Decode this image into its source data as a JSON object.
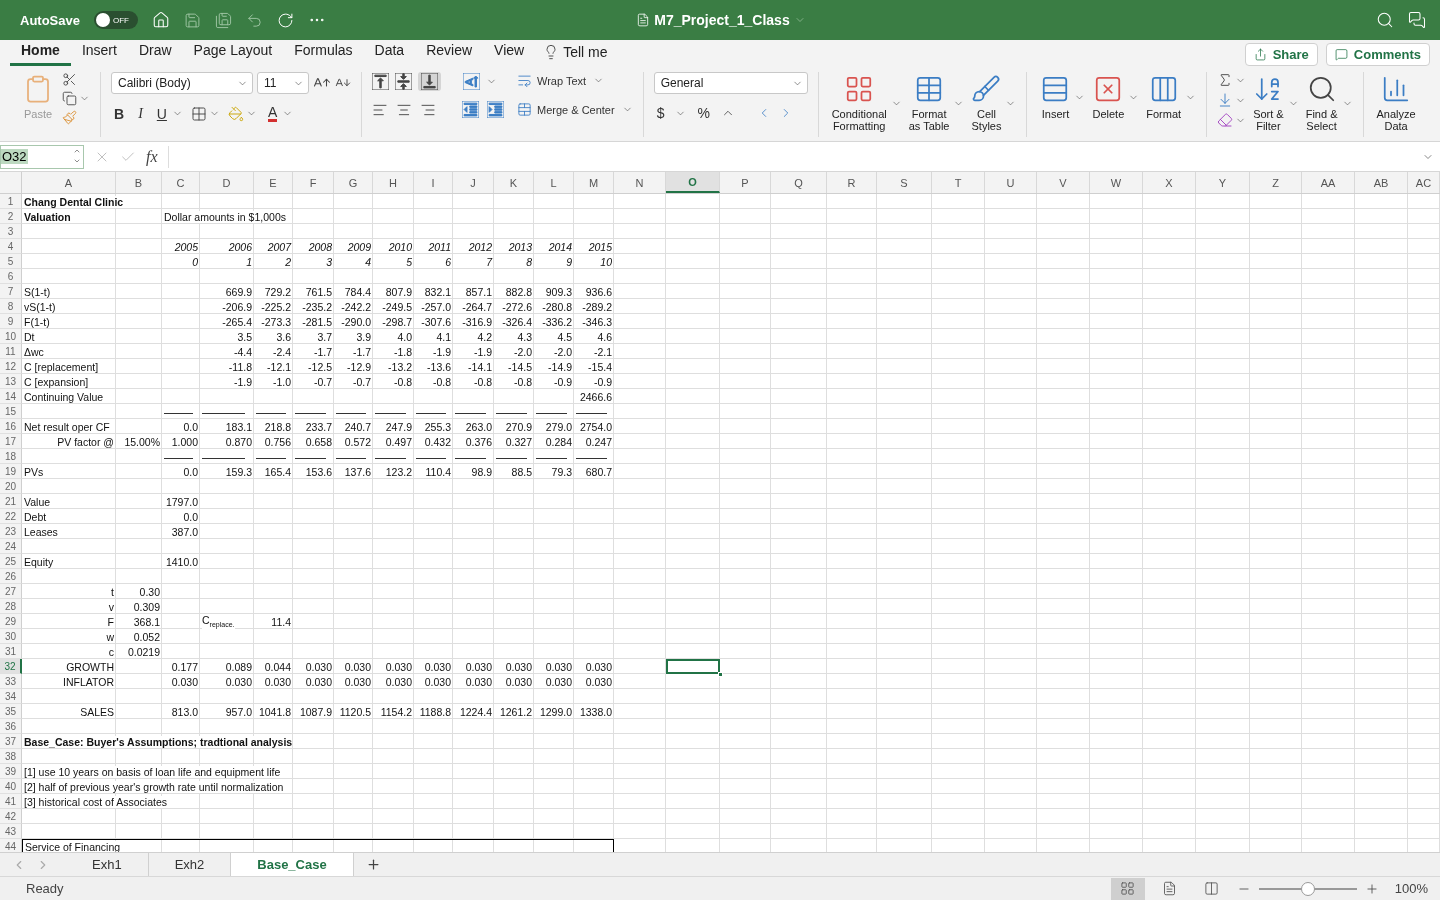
{
  "title_bar": {
    "autosave": {
      "label": "AutoSave",
      "state": "OFF",
      "on": false
    },
    "title": "M7_Project_1_Class"
  },
  "menu_tabs": [
    {
      "label": "Home",
      "selected": true
    },
    {
      "label": "Insert",
      "selected": false
    },
    {
      "label": "Draw",
      "selected": false
    },
    {
      "label": "Page Layout",
      "selected": false
    },
    {
      "label": "Formulas",
      "selected": false
    },
    {
      "label": "Data",
      "selected": false
    },
    {
      "label": "Review",
      "selected": false
    },
    {
      "label": "View",
      "selected": false
    }
  ],
  "tell_me": "Tell me",
  "share": "Share",
  "comments": "Comments",
  "ribbon": {
    "paste": "Paste",
    "font_name": "Calibri (Body)",
    "font_size": "11",
    "bold": "B",
    "italic": "I",
    "underline": "U",
    "font_color": "A",
    "wrap_text": "Wrap Text",
    "merge_center": "Merge & Center",
    "number_format": "General",
    "currency": "$",
    "percent": "%",
    "large_buttons": [
      {
        "kind": "conditional",
        "lines": [
          "Conditional",
          "Formatting"
        ]
      },
      {
        "kind": "table",
        "lines": [
          "Format",
          "as Table"
        ]
      },
      {
        "kind": "styles",
        "lines": [
          "Cell",
          "Styles"
        ]
      },
      {
        "kind": "insert",
        "lines": [
          "Insert"
        ]
      },
      {
        "kind": "delete",
        "lines": [
          "Delete"
        ]
      },
      {
        "kind": "format",
        "lines": [
          "Format"
        ]
      },
      {
        "kind": "sort",
        "lines": [
          "Sort &",
          "Filter"
        ]
      },
      {
        "kind": "find",
        "lines": [
          "Find &",
          "Select"
        ]
      },
      {
        "kind": "analyze",
        "lines": [
          "Analyze",
          "Data"
        ]
      }
    ]
  },
  "formula_bar": {
    "name_box": "O32",
    "function_label": "fx"
  },
  "columns": [
    {
      "label": "A",
      "selected": false
    },
    {
      "label": "B",
      "selected": false
    },
    {
      "label": "C",
      "selected": false
    },
    {
      "label": "D",
      "selected": false
    },
    {
      "label": "E",
      "selected": false
    },
    {
      "label": "F",
      "selected": false
    },
    {
      "label": "G",
      "selected": false
    },
    {
      "label": "H",
      "selected": false
    },
    {
      "label": "I",
      "selected": false
    },
    {
      "label": "J",
      "selected": false
    },
    {
      "label": "K",
      "selected": false
    },
    {
      "label": "L",
      "selected": false
    },
    {
      "label": "M",
      "selected": false
    },
    {
      "label": "N",
      "selected": false
    },
    {
      "label": "O",
      "selected": true
    },
    {
      "label": "P",
      "selected": false
    },
    {
      "label": "Q",
      "selected": false
    },
    {
      "label": "R",
      "selected": false
    },
    {
      "label": "S",
      "selected": false
    },
    {
      "label": "T",
      "selected": false
    },
    {
      "label": "U",
      "selected": false
    },
    {
      "label": "V",
      "selected": false
    },
    {
      "label": "W",
      "selected": false
    },
    {
      "label": "X",
      "selected": false
    },
    {
      "label": "Y",
      "selected": false
    },
    {
      "label": "Z",
      "selected": false
    },
    {
      "label": "AA",
      "selected": false
    },
    {
      "label": "AB",
      "selected": false
    },
    {
      "label": "AC",
      "selected": false
    }
  ],
  "rows": [
    {
      "number": "1",
      "selected": false,
      "cells": {
        "A": {
          "kind": "text",
          "text": "Chang Dental Clinic",
          "bold": true
        }
      }
    },
    {
      "number": "2",
      "selected": false,
      "cells": {
        "A": {
          "kind": "text",
          "text": "Valuation",
          "bold": true
        },
        "C": {
          "kind": "text",
          "text": "Dollar amounts in $1,000s"
        }
      }
    },
    {
      "number": "3",
      "selected": false
    },
    {
      "number": "4",
      "selected": false,
      "cells": {
        "C": {
          "kind": "value",
          "text": "2005",
          "italic": true
        },
        "D": {
          "kind": "value",
          "text": "2006",
          "italic": true
        },
        "E": {
          "kind": "value",
          "text": "2007",
          "italic": true
        },
        "F": {
          "kind": "value",
          "text": "2008",
          "italic": true
        },
        "G": {
          "kind": "value",
          "text": "2009",
          "italic": true
        },
        "H": {
          "kind": "value",
          "text": "2010",
          "italic": true
        },
        "I": {
          "kind": "value",
          "text": "2011",
          "italic": true
        },
        "J": {
          "kind": "value",
          "text": "2012",
          "italic": true
        },
        "K": {
          "kind": "value",
          "text": "2013",
          "italic": true
        },
        "L": {
          "kind": "value",
          "text": "2014",
          "italic": true
        },
        "M": {
          "kind": "value",
          "text": "2015",
          "italic": true
        }
      }
    },
    {
      "number": "5",
      "selected": false,
      "cells": {
        "C": {
          "kind": "value",
          "text": "0",
          "italic": true
        },
        "D": {
          "kind": "value",
          "text": "1",
          "italic": true
        },
        "E": {
          "kind": "value",
          "text": "2",
          "italic": true
        },
        "F": {
          "kind": "value",
          "text": "3",
          "italic": true
        },
        "G": {
          "kind": "value",
          "text": "4",
          "italic": true
        },
        "H": {
          "kind": "value",
          "text": "5",
          "italic": true
        },
        "I": {
          "kind": "value",
          "text": "6",
          "italic": true
        },
        "J": {
          "kind": "value",
          "text": "7",
          "italic": true
        },
        "K": {
          "kind": "value",
          "text": "8",
          "italic": true
        },
        "L": {
          "kind": "value",
          "text": "9",
          "italic": true
        },
        "M": {
          "kind": "value",
          "text": "10",
          "italic": true
        }
      }
    },
    {
      "number": "6",
      "selected": false
    },
    {
      "number": "7",
      "selected": false,
      "cells": {
        "A": {
          "kind": "text",
          "text": "S(1-t)"
        },
        "D": {
          "kind": "value",
          "text": "669.9"
        },
        "E": {
          "kind": "value",
          "text": "729.2"
        },
        "F": {
          "kind": "value",
          "text": "761.5"
        },
        "G": {
          "kind": "value",
          "text": "784.4"
        },
        "H": {
          "kind": "value",
          "text": "807.9"
        },
        "I": {
          "kind": "value",
          "text": "832.1"
        },
        "J": {
          "kind": "value",
          "text": "857.1"
        },
        "K": {
          "kind": "value",
          "text": "882.8"
        },
        "L": {
          "kind": "value",
          "text": "909.3"
        },
        "M": {
          "kind": "value",
          "text": "936.6"
        }
      }
    },
    {
      "number": "8",
      "selected": false,
      "cells": {
        "A": {
          "kind": "text",
          "text": "vS(1-t)"
        },
        "D": {
          "kind": "value",
          "text": "-206.9"
        },
        "E": {
          "kind": "value",
          "text": "-225.2"
        },
        "F": {
          "kind": "value",
          "text": "-235.2"
        },
        "G": {
          "kind": "value",
          "text": "-242.2"
        },
        "H": {
          "kind": "value",
          "text": "-249.5"
        },
        "I": {
          "kind": "value",
          "text": "-257.0"
        },
        "J": {
          "kind": "value",
          "text": "-264.7"
        },
        "K": {
          "kind": "value",
          "text": "-272.6"
        },
        "L": {
          "kind": "value",
          "text": "-280.8"
        },
        "M": {
          "kind": "value",
          "text": "-289.2"
        }
      }
    },
    {
      "number": "9",
      "selected": false,
      "cells": {
        "A": {
          "kind": "text",
          "text": "F(1-t)"
        },
        "D": {
          "kind": "value",
          "text": "-265.4"
        },
        "E": {
          "kind": "value",
          "text": "-273.3"
        },
        "F": {
          "kind": "value",
          "text": "-281.5"
        },
        "G": {
          "kind": "value",
          "text": "-290.0"
        },
        "H": {
          "kind": "value",
          "text": "-298.7"
        },
        "I": {
          "kind": "value",
          "text": "-307.6"
        },
        "J": {
          "kind": "value",
          "text": "-316.9"
        },
        "K": {
          "kind": "value",
          "text": "-326.4"
        },
        "L": {
          "kind": "value",
          "text": "-336.2"
        },
        "M": {
          "kind": "value",
          "text": "-346.3"
        }
      }
    },
    {
      "number": "10",
      "selected": false,
      "cells": {
        "A": {
          "kind": "text",
          "text": "Dt"
        },
        "D": {
          "kind": "value",
          "text": "3.5"
        },
        "E": {
          "kind": "value",
          "text": "3.6"
        },
        "F": {
          "kind": "value",
          "text": "3.7"
        },
        "G": {
          "kind": "value",
          "text": "3.9"
        },
        "H": {
          "kind": "value",
          "text": "4.0"
        },
        "I": {
          "kind": "value",
          "text": "4.1"
        },
        "J": {
          "kind": "value",
          "text": "4.2"
        },
        "K": {
          "kind": "value",
          "text": "4.3"
        },
        "L": {
          "kind": "value",
          "text": "4.5"
        },
        "M": {
          "kind": "value",
          "text": "4.6"
        }
      }
    },
    {
      "number": "11",
      "selected": false,
      "cells": {
        "A": {
          "kind": "text",
          "text": "Δwc"
        },
        "D": {
          "kind": "value",
          "text": "-4.4"
        },
        "E": {
          "kind": "value",
          "text": "-2.4"
        },
        "F": {
          "kind": "value",
          "text": "-1.7"
        },
        "G": {
          "kind": "value",
          "text": "-1.7"
        },
        "H": {
          "kind": "value",
          "text": "-1.8"
        },
        "I": {
          "kind": "value",
          "text": "-1.9"
        },
        "J": {
          "kind": "value",
          "text": "-1.9"
        },
        "K": {
          "kind": "value",
          "text": "-2.0"
        },
        "L": {
          "kind": "value",
          "text": "-2.0"
        },
        "M": {
          "kind": "value",
          "text": "-2.1"
        }
      }
    },
    {
      "number": "12",
      "selected": false,
      "cells": {
        "A": {
          "kind": "text",
          "text": "C [replacement]"
        },
        "D": {
          "kind": "value",
          "text": "-11.8"
        },
        "E": {
          "kind": "value",
          "text": "-12.1"
        },
        "F": {
          "kind": "value",
          "text": "-12.5"
        },
        "G": {
          "kind": "value",
          "text": "-12.9"
        },
        "H": {
          "kind": "value",
          "text": "-13.2"
        },
        "I": {
          "kind": "value",
          "text": "-13.6"
        },
        "J": {
          "kind": "value",
          "text": "-14.1"
        },
        "K": {
          "kind": "value",
          "text": "-14.5"
        },
        "L": {
          "kind": "value",
          "text": "-14.9"
        },
        "M": {
          "kind": "value",
          "text": "-15.4"
        }
      }
    },
    {
      "number": "13",
      "selected": false,
      "cells": {
        "A": {
          "kind": "text",
          "text": "C [expansion]"
        },
        "D": {
          "kind": "value",
          "text": "-1.9"
        },
        "E": {
          "kind": "value",
          "text": "-1.0"
        },
        "F": {
          "kind": "value",
          "text": "-0.7"
        },
        "G": {
          "kind": "value",
          "text": "-0.7"
        },
        "H": {
          "kind": "value",
          "text": "-0.8"
        },
        "I": {
          "kind": "value",
          "text": "-0.8"
        },
        "J": {
          "kind": "value",
          "text": "-0.8"
        },
        "K": {
          "kind": "value",
          "text": "-0.8"
        },
        "L": {
          "kind": "value",
          "text": "-0.9"
        },
        "M": {
          "kind": "value",
          "text": "-0.9"
        }
      }
    },
    {
      "number": "14",
      "selected": false,
      "cells": {
        "A": {
          "kind": "text",
          "text": "Continuing Value"
        },
        "M": {
          "kind": "value",
          "text": "2466.6"
        }
      }
    },
    {
      "number": "15",
      "selected": false,
      "cells": {
        "C": {
          "kind": "rule"
        },
        "D": {
          "kind": "rule"
        },
        "E": {
          "kind": "rule"
        },
        "F": {
          "kind": "rule"
        },
        "G": {
          "kind": "rule"
        },
        "H": {
          "kind": "rule"
        },
        "I": {
          "kind": "rule"
        },
        "J": {
          "kind": "rule"
        },
        "K": {
          "kind": "rule"
        },
        "L": {
          "kind": "rule"
        },
        "M": {
          "kind": "rule"
        }
      }
    },
    {
      "number": "16",
      "selected": false,
      "cells": {
        "A": {
          "kind": "text",
          "text": "Net result oper CF"
        },
        "C": {
          "kind": "value",
          "text": "0.0"
        },
        "D": {
          "kind": "value",
          "text": "183.1"
        },
        "E": {
          "kind": "value",
          "text": "218.8"
        },
        "F": {
          "kind": "value",
          "text": "233.7"
        },
        "G": {
          "kind": "value",
          "text": "240.7"
        },
        "H": {
          "kind": "value",
          "text": "247.9"
        },
        "I": {
          "kind": "value",
          "text": "255.3"
        },
        "J": {
          "kind": "value",
          "text": "263.0"
        },
        "K": {
          "kind": "value",
          "text": "270.9"
        },
        "L": {
          "kind": "value",
          "text": "279.0"
        },
        "M": {
          "kind": "value",
          "text": "2754.0"
        }
      }
    },
    {
      "number": "17",
      "selected": false,
      "cells": {
        "A": {
          "kind": "value",
          "text": "PV factor @"
        },
        "B": {
          "kind": "value",
          "text": "15.00%"
        },
        "C": {
          "kind": "value",
          "text": "1.000"
        },
        "D": {
          "kind": "value",
          "text": "0.870"
        },
        "E": {
          "kind": "value",
          "text": "0.756"
        },
        "F": {
          "kind": "value",
          "text": "0.658"
        },
        "G": {
          "kind": "value",
          "text": "0.572"
        },
        "H": {
          "kind": "value",
          "text": "0.497"
        },
        "I": {
          "kind": "value",
          "text": "0.432"
        },
        "J": {
          "kind": "value",
          "text": "0.376"
        },
        "K": {
          "kind": "value",
          "text": "0.327"
        },
        "L": {
          "kind": "value",
          "text": "0.284"
        },
        "M": {
          "kind": "value",
          "text": "0.247"
        }
      }
    },
    {
      "number": "18",
      "selected": false,
      "cells": {
        "C": {
          "kind": "rule"
        },
        "D": {
          "kind": "rule"
        },
        "E": {
          "kind": "rule"
        },
        "F": {
          "kind": "rule"
        },
        "G": {
          "kind": "rule"
        },
        "H": {
          "kind": "rule"
        },
        "I": {
          "kind": "rule"
        },
        "J": {
          "kind": "rule"
        },
        "K": {
          "kind": "rule"
        },
        "L": {
          "kind": "rule"
        },
        "M": {
          "kind": "rule"
        }
      }
    },
    {
      "number": "19",
      "selected": false,
      "cells": {
        "A": {
          "kind": "text",
          "text": "PVs"
        },
        "C": {
          "kind": "value",
          "text": "0.0"
        },
        "D": {
          "kind": "value",
          "text": "159.3"
        },
        "E": {
          "kind": "value",
          "text": "165.4"
        },
        "F": {
          "kind": "value",
          "text": "153.6"
        },
        "G": {
          "kind": "value",
          "text": "137.6"
        },
        "H": {
          "kind": "value",
          "text": "123.2"
        },
        "I": {
          "kind": "value",
          "text": "110.4"
        },
        "J": {
          "kind": "value",
          "text": "98.9"
        },
        "K": {
          "kind": "value",
          "text": "88.5"
        },
        "L": {
          "kind": "value",
          "text": "79.3"
        },
        "M": {
          "kind": "value",
          "text": "680.7"
        }
      }
    },
    {
      "number": "20",
      "selected": false
    },
    {
      "number": "21",
      "selected": false,
      "cells": {
        "A": {
          "kind": "text",
          "text": "Value"
        },
        "C": {
          "kind": "value",
          "text": "1797.0"
        }
      }
    },
    {
      "number": "22",
      "selected": false,
      "cells": {
        "A": {
          "kind": "text",
          "text": "Debt"
        },
        "C": {
          "kind": "value",
          "text": "0.0"
        }
      }
    },
    {
      "number": "23",
      "selected": false,
      "cells": {
        "A": {
          "kind": "text",
          "text": "Leases"
        },
        "C": {
          "kind": "value",
          "text": "387.0"
        }
      }
    },
    {
      "number": "24",
      "selected": false
    },
    {
      "number": "25",
      "selected": false,
      "cells": {
        "A": {
          "kind": "text",
          "text": "Equity"
        },
        "C": {
          "kind": "value",
          "text": "1410.0"
        }
      }
    },
    {
      "number": "26",
      "selected": false
    },
    {
      "number": "27",
      "selected": false,
      "cells": {
        "A": {
          "kind": "value",
          "text": "t"
        },
        "B": {
          "kind": "value",
          "text": "0.30"
        }
      }
    },
    {
      "number": "28",
      "selected": false,
      "cells": {
        "A": {
          "kind": "value",
          "text": "v"
        },
        "B": {
          "kind": "value",
          "text": "0.309"
        }
      }
    },
    {
      "number": "29",
      "selected": false,
      "cells": {
        "A": {
          "kind": "value",
          "text": "F"
        },
        "B": {
          "kind": "value",
          "text": "368.1"
        },
        "D": {
          "kind": "text",
          "text": "C$_{replace.}$"
        },
        "E": {
          "kind": "value",
          "text": "11.4"
        }
      }
    },
    {
      "number": "30",
      "selected": false,
      "cells": {
        "A": {
          "kind": "value",
          "text": "w"
        },
        "B": {
          "kind": "value",
          "text": "0.052"
        }
      }
    },
    {
      "number": "31",
      "selected": false,
      "cells": {
        "A": {
          "kind": "value",
          "text": "c"
        },
        "B": {
          "kind": "value",
          "text": "0.0219"
        }
      }
    },
    {
      "number": "32",
      "selected": true,
      "cells": {
        "A": {
          "kind": "value",
          "text": "GROWTH"
        },
        "C": {
          "kind": "value",
          "text": "0.177"
        },
        "D": {
          "kind": "value",
          "text": "0.089"
        },
        "E": {
          "kind": "value",
          "text": "0.044"
        },
        "F": {
          "kind": "value",
          "text": "0.030"
        },
        "G": {
          "kind": "value",
          "text": "0.030"
        },
        "H": {
          "kind": "value",
          "text": "0.030"
        },
        "I": {
          "kind": "value",
          "text": "0.030"
        },
        "J": {
          "kind": "value",
          "text": "0.030"
        },
        "K": {
          "kind": "value",
          "text": "0.030"
        },
        "L": {
          "kind": "value",
          "text": "0.030"
        },
        "M": {
          "kind": "value",
          "text": "0.030"
        }
      }
    },
    {
      "number": "33",
      "selected": false,
      "cells": {
        "A": {
          "kind": "value",
          "text": "INFLATOR"
        },
        "C": {
          "kind": "value",
          "text": "0.030"
        },
        "D": {
          "kind": "value",
          "text": "0.030"
        },
        "E": {
          "kind": "value",
          "text": "0.030"
        },
        "F": {
          "kind": "value",
          "text": "0.030"
        },
        "G": {
          "kind": "value",
          "text": "0.030"
        },
        "H": {
          "kind": "value",
          "text": "0.030"
        },
        "I": {
          "kind": "value",
          "text": "0.030"
        },
        "J": {
          "kind": "value",
          "text": "0.030"
        },
        "K": {
          "kind": "value",
          "text": "0.030"
        },
        "L": {
          "kind": "value",
          "text": "0.030"
        },
        "M": {
          "kind": "value",
          "text": "0.030"
        }
      }
    },
    {
      "number": "34",
      "selected": false
    },
    {
      "number": "35",
      "selected": false,
      "cells": {
        "A": {
          "kind": "value",
          "text": "SALES"
        },
        "C": {
          "kind": "value",
          "text": "813.0"
        },
        "D": {
          "kind": "value",
          "text": "957.0"
        },
        "E": {
          "kind": "value",
          "text": "1041.8"
        },
        "F": {
          "kind": "value",
          "text": "1087.9"
        },
        "G": {
          "kind": "value",
          "text": "1120.5"
        },
        "H": {
          "kind": "value",
          "text": "1154.2"
        },
        "I": {
          "kind": "value",
          "text": "1188.8"
        },
        "J": {
          "kind": "value",
          "text": "1224.4"
        },
        "K": {
          "kind": "value",
          "text": "1261.2"
        },
        "L": {
          "kind": "value",
          "text": "1299.0"
        },
        "M": {
          "kind": "value",
          "text": "1338.0"
        }
      }
    },
    {
      "number": "36",
      "selected": false
    },
    {
      "number": "37",
      "selected": false,
      "cells": {
        "A": {
          "kind": "text",
          "text": "Base_Case: Buyer's Assumptions; tradtional analysis",
          "bold": true
        }
      }
    },
    {
      "number": "38",
      "selected": false
    },
    {
      "number": "39",
      "selected": false,
      "cells": {
        "A": {
          "kind": "text",
          "text": "[1] use 10 years on basis of loan life and equipment life"
        }
      }
    },
    {
      "number": "40",
      "selected": false,
      "cells": {
        "A": {
          "kind": "text",
          "text": "[2] half of previous year's growth rate until normalization"
        }
      }
    },
    {
      "number": "41",
      "selected": false,
      "cells": {
        "A": {
          "kind": "text",
          "text": "[3] historical cost of Associates"
        }
      }
    },
    {
      "number": "42",
      "selected": false
    },
    {
      "number": "43",
      "selected": false
    },
    {
      "number": "44",
      "selected": false,
      "cells": {
        "A": {
          "kind": "text",
          "text": "Service of Financing",
          "boxed": true
        },
        "B": {
          "boxed": true
        },
        "C": {
          "boxed": true
        },
        "D": {
          "boxed": true
        },
        "E": {
          "boxed": true
        },
        "F": {
          "boxed": true
        },
        "G": {
          "boxed": true
        },
        "H": {
          "boxed": true
        },
        "I": {
          "boxed": true
        },
        "J": {
          "boxed": true
        },
        "K": {
          "boxed": true
        },
        "L": {
          "boxed": true
        },
        "M": {
          "boxed": true
        }
      }
    }
  ],
  "sheet_tabs": [
    {
      "label": "Exh1",
      "selected": false
    },
    {
      "label": "Exh2",
      "selected": false
    },
    {
      "label": "Base_Case",
      "selected": true
    }
  ],
  "status_bar": {
    "status": "Ready",
    "views": [
      {
        "kind": "normal",
        "selected": true
      },
      {
        "kind": "page_layout",
        "selected": false
      },
      {
        "kind": "page_break",
        "selected": false
      }
    ],
    "zoom": {
      "level": 0.5,
      "reading": "100%"
    }
  }
}
